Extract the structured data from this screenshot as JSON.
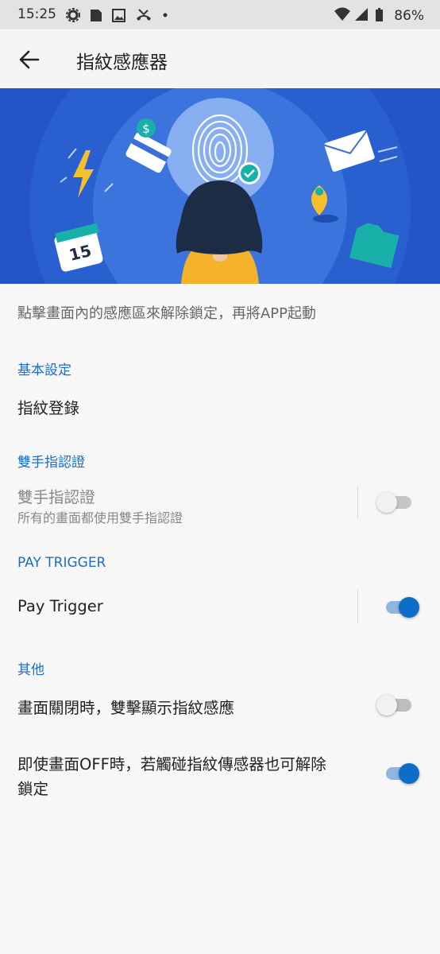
{
  "status_bar": {
    "time": "15:25",
    "battery": "86%",
    "icons": [
      "gear-icon",
      "sim-icon",
      "image-icon",
      "missed-call-icon",
      "dot-icon",
      "wifi-icon",
      "signal-icon",
      "battery-icon"
    ]
  },
  "header": {
    "title": "指紋感應器",
    "back_icon": "arrow-back-icon"
  },
  "hero": {
    "calendar_day": "15"
  },
  "description": "點擊畫面內的感應區來解除鎖定，再將APP起動",
  "sections": {
    "basic": {
      "header": "基本設定",
      "fingerprint_register": "指紋登錄"
    },
    "two_hand": {
      "header": "雙手指認證",
      "title": "雙手指認證",
      "subtitle": "所有的畫面都使用雙手指認證",
      "enabled": false,
      "available": false
    },
    "pay_trigger": {
      "header": "PAY TRIGGER",
      "title": "Pay Trigger",
      "enabled": true
    },
    "other": {
      "header": "其他",
      "double_tap_title": "畫面關閉時，雙擊顯示指紋感應",
      "double_tap_enabled": false,
      "screen_off_line1": "即使畫面OFF時，若觸碰指紋傳感器也可解除",
      "screen_off_line2": "鎖定",
      "screen_off_enabled": true
    }
  },
  "colors": {
    "accent": "#1c6fc2",
    "toggle_on": "#0c6ec6",
    "hero_bg": "#2554c8"
  }
}
